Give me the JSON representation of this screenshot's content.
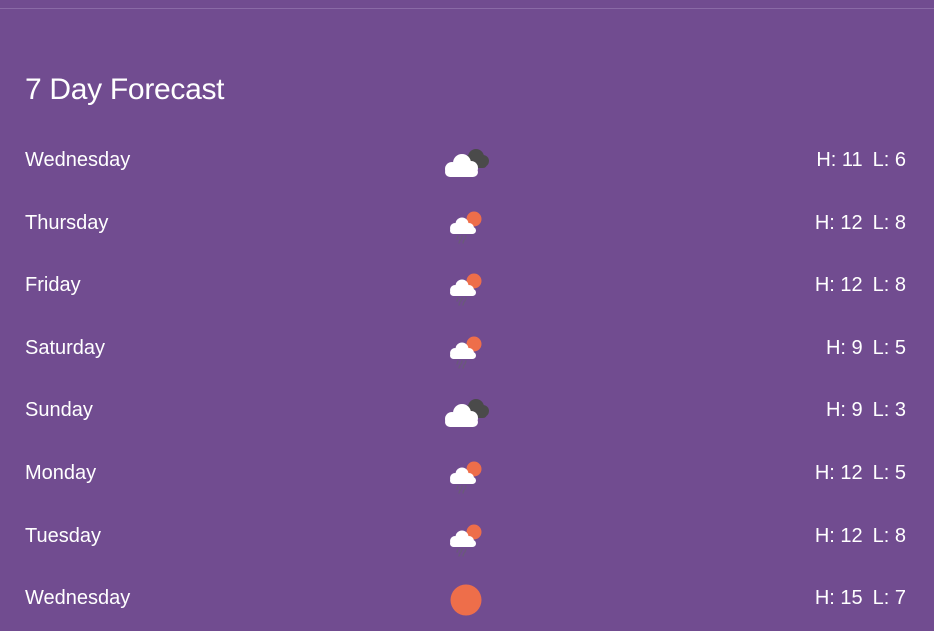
{
  "title": "7 Day Forecast",
  "days": [
    {
      "day": "Wednesday",
      "icon": "cloudy-icon",
      "high": "H: 11",
      "low": "L: 6"
    },
    {
      "day": "Thursday",
      "icon": "rain-sun-icon",
      "high": "H: 12",
      "low": "L: 8"
    },
    {
      "day": "Friday",
      "icon": "rain-sun-icon",
      "high": "H: 12",
      "low": "L: 8"
    },
    {
      "day": "Saturday",
      "icon": "rain-sun-icon",
      "high": "H: 9",
      "low": "L: 5"
    },
    {
      "day": "Sunday",
      "icon": "cloudy-icon",
      "high": "H: 9",
      "low": "L: 3"
    },
    {
      "day": "Monday",
      "icon": "rain-sun-icon",
      "high": "H: 12",
      "low": "L: 5"
    },
    {
      "day": "Tuesday",
      "icon": "rain-sun-icon",
      "high": "H: 12",
      "low": "L: 8"
    },
    {
      "day": "Wednesday",
      "icon": "sun-icon",
      "high": "H: 15",
      "low": "L: 7"
    }
  ],
  "colors": {
    "background": "#714c90",
    "sun": "#ee6e4a",
    "cloud": "#ffffff",
    "dark_cloud": "#4a4a4a",
    "rain": "#6a5a7a"
  }
}
